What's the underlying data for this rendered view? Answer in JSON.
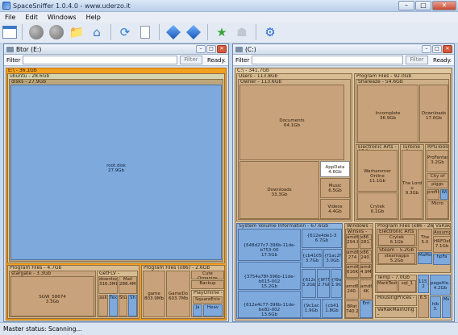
{
  "window": {
    "title": "SpaceSniffer 1.0.4.0 - www.uderzo.it",
    "minimize": "–",
    "maximize": "□",
    "close": "✕"
  },
  "menu": [
    "File",
    "Edit",
    "Windows",
    "Help"
  ],
  "toolbar": {
    "icons": [
      "new-window-icon",
      "gray-circle-icon",
      "gray-circle-icon",
      "folder-icon",
      "home-icon",
      "refresh-icon",
      "document-icon",
      "blue-cube-icon",
      "blue-cube-icon",
      "green-star-icon",
      "ghost-icon",
      "settings-gear-icon"
    ]
  },
  "left_panel": {
    "title": "Btor (E:)",
    "filter_label": "Filter",
    "filter_value": "",
    "filter_button": "Filter",
    "status": "Ready.",
    "tiles": {
      "root": "E:\\ - 36.1Gb",
      "ubuntu": "ubuntu - 28.6Gb",
      "disks": "disks - 27.9Gb",
      "root_disk": "root.disk",
      "root_disk_size": "27.9Gb",
      "program_files": "Program Files - 4.7Gb",
      "program_files_x86": "Program Files (x86) - 2.6Gb",
      "stargate": "stargate - 3.3Gb",
      "sgw": "SGW_58674",
      "sgw_size": "3.3Gb",
      "getflv": "GetFLV -",
      "download": "download",
      "download_size": "316.3Mb",
      "mail": "Mail",
      "mail_size": "288.4Mb",
      "ask": "ask",
      "tex": "Tex",
      "stu": "Stu",
      "sh": "Sh",
      "game": "game",
      "game_size": "803.9Mb",
      "gamedo": "GameDo",
      "gamedo_size": "603.7Mb",
      "cute": "Cute Organize",
      "backup": "Backup",
      "playonline": "PlayOnline -",
      "squareenix": "SquareEnix",
      "ja": "Ja",
      "heav": "Heav"
    }
  },
  "right_panel": {
    "title": "(C:)",
    "filter_label": "Filter",
    "filter_value": "",
    "filter_button": "Filter",
    "status": "Ready.",
    "tiles": {
      "root": "C:\\ - 341.7Gb",
      "users": "Users - 113.8Gb",
      "owner": "Owner - 113.6Gb",
      "documents": "Documents",
      "documents_size": "64.1Gb",
      "downloads": "Downloads",
      "downloads_size": "33.3Gb",
      "appdata": "AppData",
      "appdata_size": "4.6Gb",
      "music": "Music",
      "music_size": "6.5Gb",
      "videos": "Videos",
      "videos_size": "4.4Gb",
      "program_files": "Program Files - 92.0Gb",
      "shareaze": "Shareaze - 54.6Gb",
      "incomplete": "Incomplete",
      "incomplete_size": "36.9Gb",
      "downloads2": "Downloads",
      "downloads2_size": "17.6Gb",
      "electronic_arts": "Electronic Arts - 17.2",
      "turbine": "Turbine - 9",
      "rpg_tools": "RPGTools -",
      "warhammer": "Warhammer Online",
      "warhammer_size": "11.1Gb",
      "lord": "The Lord o",
      "lord_size": "9.3Gb",
      "crytek": "Crytek",
      "crytek_size": "6.1Gb",
      "profan": "ProFantas",
      "profan_size": "3.2Gb",
      "city": "City of He",
      "piggs": "piggs",
      "profile": "profile",
      "micro": "Micro",
      "wi": "Wi",
      "svi": "System Volume Information - 67.6Gb",
      "svi_a": "{648d27c7-396b-11de-b753-00",
      "svi_a_size": "17.5Gb",
      "svi_b": "{3754a78f-396b-11de-b615-002",
      "svi_b_size": "15.2Gb",
      "svi_c": "{612e4c77-396b-11de-be82-002",
      "svi_c_size": "13.6Gb",
      "svi_d": "{612e4de1-3",
      "svi_d_size": "6.7Gb",
      "svi_e": "{cb410530",
      "svi_e_size": "3.7Gb",
      "svi_f": "{f1ac2f",
      "svi_f_size": "3.0Gb",
      "svi_g": "{612e4d",
      "svi_g_size": "5.2Gb",
      "svi_h": "{9f75a",
      "svi_h_size": "2.7Gb",
      "svi_i": "{f9a3",
      "svi_i_size": "1.9Gb",
      "svi_j": "{9c1ac",
      "svi_j_size": "1.9Gb",
      "svi_k": "{cb41",
      "svi_k_size": "1.8Gb",
      "windows": "Windows - 11.",
      "winsxs": "winsxs - 6.2",
      "amd1": "amd6",
      "amd1_size": "294.8",
      "x86_1": "x86_",
      "x86_1_size": "281.",
      "amd2": "amd6",
      "amd2_size": "274",
      "x86_2": "x86_",
      "x86_2_size": "240.",
      "amd3": "amd6",
      "amd3_size": "616K",
      "amd4": "amd6",
      "amd4_size": "4.9M",
      "amd5": "amd6",
      "amd5_size": "240.",
      "amd6": "amd6",
      "amd6_size": "4K",
      "program_files_x86": "Program Files (x86 - 26.",
      "ea2": "Electronic Arts -",
      "crytek2": "Crytek",
      "crytek2_size": "6.1Gb",
      "the": "The",
      "the_size": "5.0",
      "steam": "Steam - 5.2Gb",
      "steamapps": "steamapps",
      "steamapps_size": "5.2Gb",
      "varakk": "VaRakMain",
      "varakk2": "VaRakk",
      "assumpt": "Assumpt",
      "hrfde": "HRFDeFirst",
      "hrfde_size": "7.1Gb",
      "mamo": "MaMo",
      "hpfa": "hpFa",
      "temp": "Temp - 7.0Gb",
      "marktest": "MarkTest1",
      "sql": "sql_1",
      "bpat": "BPat",
      "bpat_size": "740.2",
      "ll5": "115_0",
      "ll5_size": "2",
      "pagefile": "pagefile.s",
      "pagefile_size": "4.2Gb",
      "hib": "hib",
      "hib_size": "3.",
      "housingprices": "HousingPrices -",
      "varak2": "VaRakMainOrig -",
      "sx": "6.5",
      "ent": "Ent",
      "ms": "Ms"
    }
  },
  "status": {
    "text": "Master status: Scanning..."
  }
}
